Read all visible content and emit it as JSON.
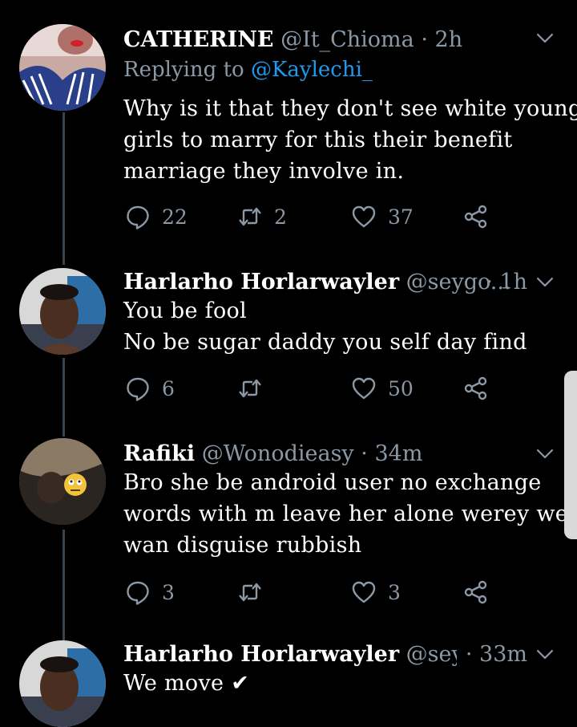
{
  "tweets": [
    {
      "name": "CATHERINE",
      "handle": "@It_Chioma",
      "time": "2h",
      "replying_label": "Replying to",
      "replying_to": "@Kaylechi_",
      "lines": [
        "Why is it that they don't see white young",
        "girls to marry for this their benefit",
        "marriage they involve in."
      ],
      "replies": "22",
      "retweets": "2",
      "likes": "37"
    },
    {
      "name": "Harlarho Horlarwayler",
      "handle": "@seygo...",
      "time": "1h",
      "lines": [
        "You be fool",
        "No be sugar daddy you self day find"
      ],
      "replies": "6",
      "retweets": "",
      "likes": "50"
    },
    {
      "name": "Rafiki",
      "handle": "@Wonodieasy",
      "time": "34m",
      "lines": [
        "Bro she be android user no exchange",
        "words with m leave her alone werey wey",
        "wan disguise rubbish"
      ],
      "replies": "3",
      "retweets": "",
      "likes": "3"
    },
    {
      "name": "Harlarho Horlarwayler",
      "handle": "@seyg...",
      "time": "33m",
      "lines": [
        "We move"
      ],
      "emoji": "✔"
    }
  ],
  "separator": "·",
  "icons": {
    "reply": "reply-icon",
    "retweet": "retweet-icon",
    "like": "heart-icon",
    "share": "share-icon",
    "more": "chevron-down-icon"
  },
  "colors": {
    "background": "#000000",
    "text": "#ffffff",
    "muted": "#8b98a5",
    "link": "#1d9bf0",
    "thread_line": "#38444d"
  }
}
